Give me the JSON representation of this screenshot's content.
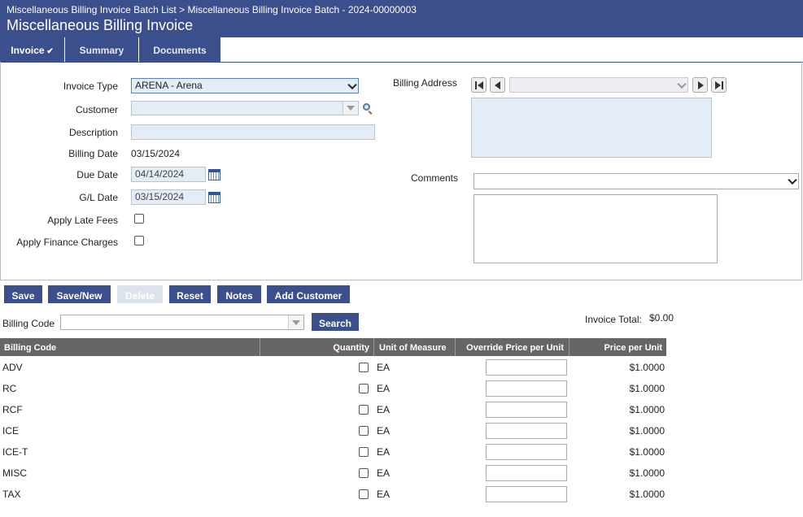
{
  "header": {
    "breadcrumb": "Miscellaneous Billing Invoice Batch List > Miscellaneous Billing Invoice Batch - 2024-00000003",
    "title": "Miscellaneous Billing Invoice"
  },
  "tabs": [
    {
      "label": "Invoice",
      "active": true
    },
    {
      "label": "Summary",
      "active": false
    },
    {
      "label": "Documents",
      "active": false
    }
  ],
  "form": {
    "invoice_type_label": "Invoice Type",
    "invoice_type_value": "ARENA - Arena",
    "customer_label": "Customer",
    "customer_value": "",
    "description_label": "Description",
    "description_value": "",
    "billing_date_label": "Billing Date",
    "billing_date_value": "03/15/2024",
    "due_date_label": "Due Date",
    "due_date_value": "04/14/2024",
    "gl_date_label": "G/L Date",
    "gl_date_value": "03/15/2024",
    "apply_late_fees_label": "Apply Late Fees",
    "apply_finance_charges_label": "Apply Finance Charges",
    "billing_address_label": "Billing Address",
    "comments_label": "Comments"
  },
  "toolbar": {
    "save": "Save",
    "save_new": "Save/New",
    "delete": "Delete",
    "reset": "Reset",
    "notes": "Notes",
    "add_customer": "Add Customer"
  },
  "billing_code_search": {
    "label": "Billing Code",
    "button": "Search"
  },
  "invoice_total": {
    "label": "Invoice Total:",
    "value": "$0.00"
  },
  "grid": {
    "columns": [
      "Billing Code",
      "Quantity",
      "Unit of Measure",
      "Override Price per Unit",
      "Price per Unit"
    ],
    "rows": [
      {
        "code": "ADV",
        "uom": "EA",
        "price": "$1.0000"
      },
      {
        "code": "RC",
        "uom": "EA",
        "price": "$1.0000"
      },
      {
        "code": "RCF",
        "uom": "EA",
        "price": "$1.0000"
      },
      {
        "code": "ICE",
        "uom": "EA",
        "price": "$1.0000"
      },
      {
        "code": "ICE-T",
        "uom": "EA",
        "price": "$1.0000"
      },
      {
        "code": "MISC",
        "uom": "EA",
        "price": "$1.0000"
      },
      {
        "code": "TAX",
        "uom": "EA",
        "price": "$1.0000"
      }
    ]
  },
  "colors": {
    "primary": "#3b4f8c",
    "grid_header": "#666666",
    "input_bg": "#e4edf6"
  }
}
